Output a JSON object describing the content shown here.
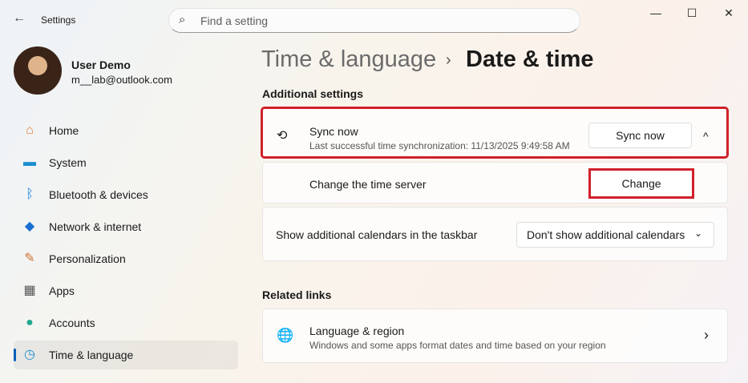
{
  "window": {
    "title": "Settings",
    "back_icon": "←",
    "minimize": "—",
    "maximize": "☐",
    "close": "✕"
  },
  "search": {
    "placeholder": "Find a setting"
  },
  "user": {
    "name": "User Demo",
    "email": "m__lab@outlook.com"
  },
  "sidebar": {
    "items": [
      {
        "label": "Home",
        "icon": "⌂",
        "color": "#e07a3a"
      },
      {
        "label": "System",
        "icon": "▬",
        "color": "#1a8fd0"
      },
      {
        "label": "Bluetooth & devices",
        "icon": "ᛒ",
        "color": "#1a7fe0"
      },
      {
        "label": "Network & internet",
        "icon": "◆",
        "color": "#1a6fd0"
      },
      {
        "label": "Personalization",
        "icon": "✎",
        "color": "#d07030"
      },
      {
        "label": "Apps",
        "icon": "▦",
        "color": "#555"
      },
      {
        "label": "Accounts",
        "icon": "●",
        "color": "#20a890"
      },
      {
        "label": "Time & language",
        "icon": "◷",
        "color": "#2090d0"
      }
    ]
  },
  "breadcrumb": {
    "parent": "Time & language",
    "separator": "›",
    "current": "Date & time"
  },
  "additional": {
    "heading": "Additional settings",
    "sync": {
      "title": "Sync now",
      "subtitle": "Last successful time synchronization: 11/13/2025 9:49:58 AM",
      "button": "Sync now",
      "chevron": "^"
    },
    "server": {
      "label": "Change the time server",
      "button": "Change"
    },
    "calendars": {
      "label": "Show additional calendars in the taskbar",
      "value": "Don't show additional calendars",
      "chevron": "⌄"
    }
  },
  "related": {
    "heading": "Related links",
    "language": {
      "title": "Language & region",
      "subtitle": "Windows and some apps format dates and time based on your region",
      "chevron": "›"
    }
  }
}
